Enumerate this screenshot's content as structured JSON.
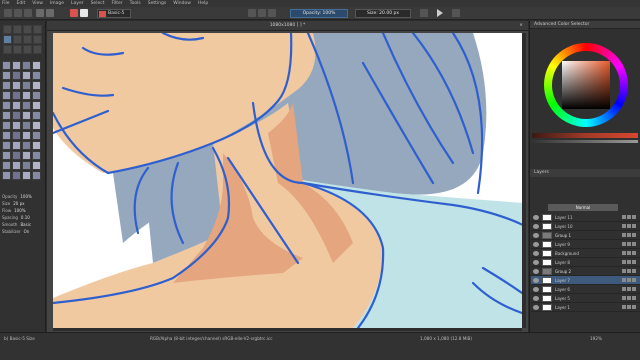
{
  "menu": [
    "File",
    "Edit",
    "View",
    "Image",
    "Layer",
    "Select",
    "Filter",
    "Tools",
    "Settings",
    "Window",
    "Help"
  ],
  "toolbar": {
    "brush_preset": "Basic-5",
    "opacity": "Opacity: 100%",
    "size": "Size: 20.00 px"
  },
  "document_tab": "1080x1080 [ ] *",
  "tool_options": [
    {
      "label": "Opacity",
      "value": "100%"
    },
    {
      "label": "Size",
      "value": "20 px"
    },
    {
      "label": "Flow",
      "value": "100%"
    },
    {
      "label": "Spacing",
      "value": "0.10"
    },
    {
      "label": "Smooth",
      "value": "Basic"
    },
    {
      "label": "Stabilizer",
      "value": "On"
    }
  ],
  "dock": {
    "color_title": "Advanced Color Selector",
    "layers_title": "Layers",
    "layer_filter": "Normal",
    "layers": [
      {
        "name": "Layer 11",
        "active": false,
        "group": false
      },
      {
        "name": "Layer 10",
        "active": false,
        "group": false
      },
      {
        "name": "Group 1",
        "active": false,
        "group": true
      },
      {
        "name": "Layer 9",
        "active": false,
        "group": false
      },
      {
        "name": "Background",
        "active": false,
        "group": false
      },
      {
        "name": "Layer 8",
        "active": false,
        "group": false
      },
      {
        "name": "Group 2",
        "active": false,
        "group": true
      },
      {
        "name": "Layer 7",
        "active": true,
        "group": false
      },
      {
        "name": "Layer 6",
        "active": false,
        "group": false
      },
      {
        "name": "Layer 5",
        "active": false,
        "group": false
      },
      {
        "name": "Layer 1",
        "active": false,
        "group": false
      }
    ]
  },
  "status": {
    "left": "b) Basic-5 Size",
    "middle": "RGB/Alpha (8-bit integer/channel) sRGB-elle-V2-srgbtrc.icc",
    "right_size": "1,080 x 1,080 (12.8 MiB)",
    "zoom": "192%"
  },
  "colors": {
    "skin": "#f0c9a0",
    "skin_shadow": "#e4a57f",
    "hair": "#96a8be",
    "hair_line": "#2f5fcf",
    "shirt": "#bfe3e6",
    "accent": "#3e5b7d"
  }
}
